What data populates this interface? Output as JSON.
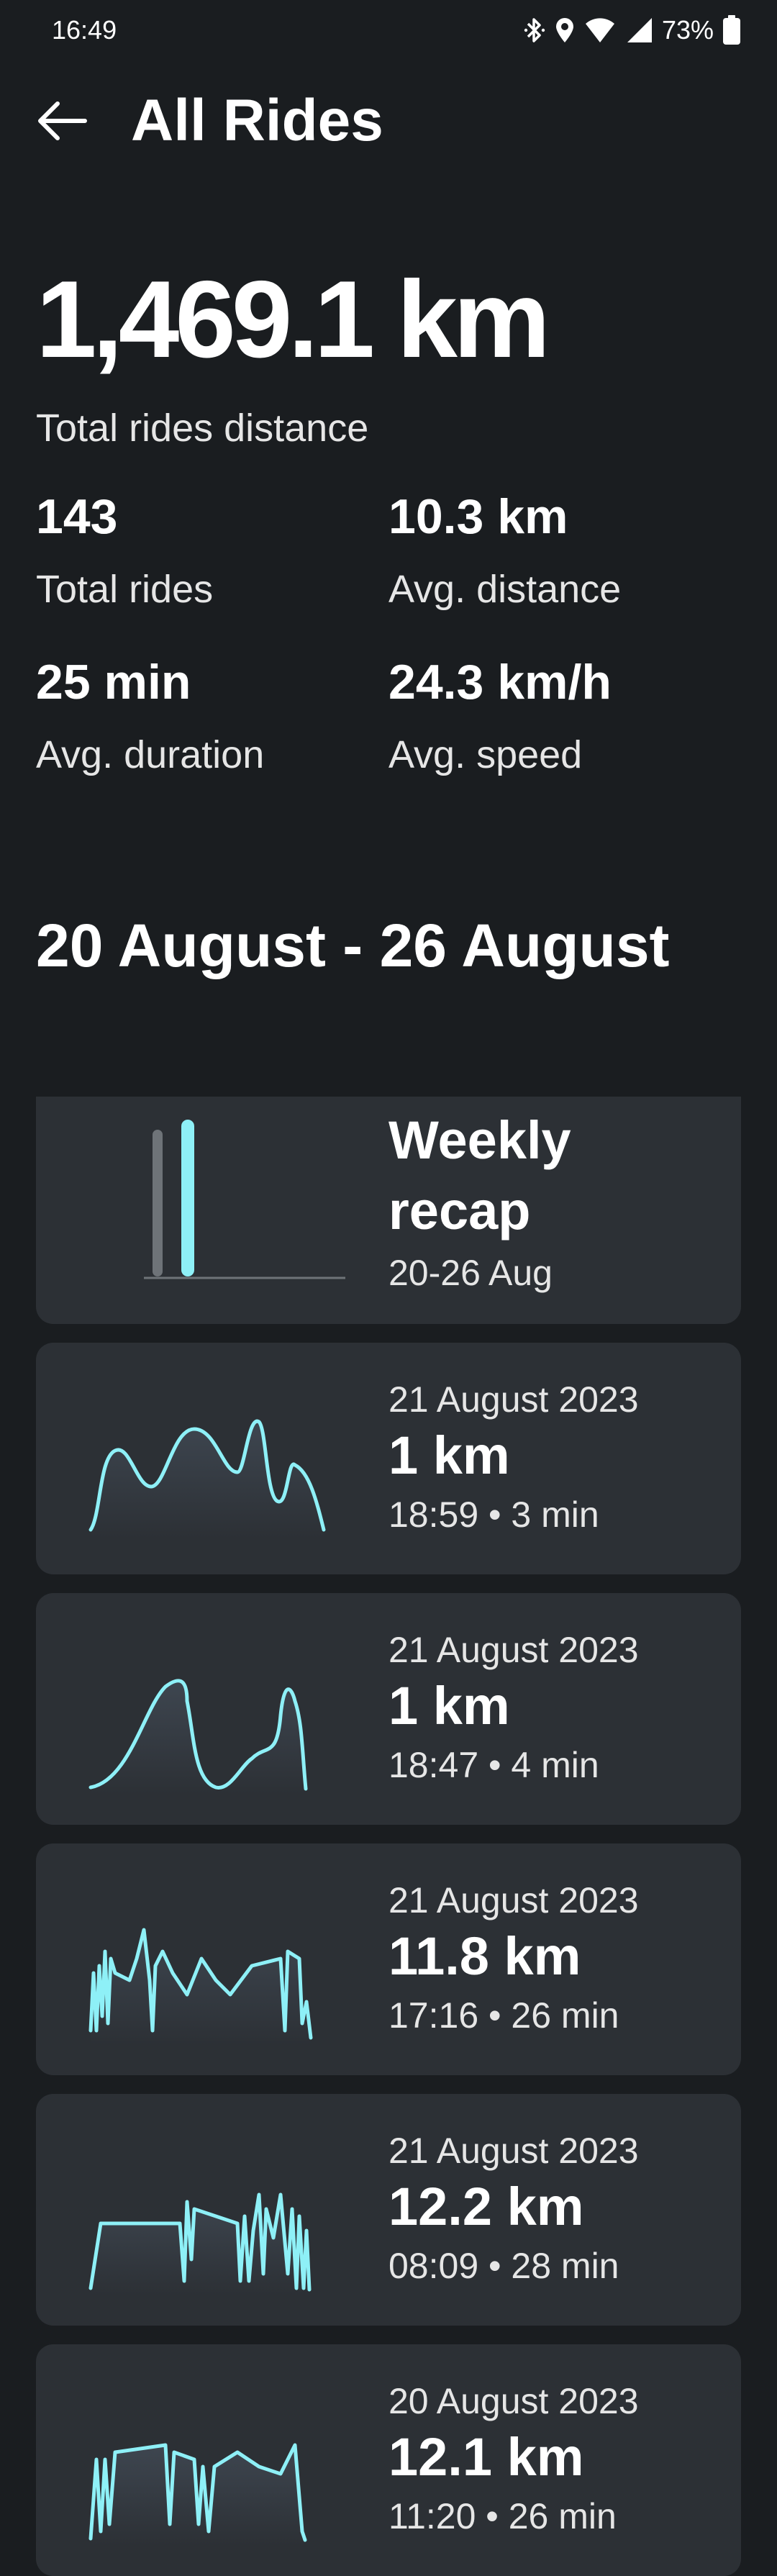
{
  "status_bar": {
    "time": "16:49",
    "battery": "73%",
    "icons": [
      "bluetooth-icon",
      "location-icon",
      "wifi-icon",
      "signal-icon",
      "battery-icon"
    ]
  },
  "header": {
    "title": "All Rides",
    "back_icon": "arrow-left-icon"
  },
  "summary": {
    "total_distance": "1,469.1 km",
    "total_distance_label": "Total rides distance",
    "stats": [
      {
        "value": "143",
        "label": "Total rides"
      },
      {
        "value": "10.3 km",
        "label": "Avg. distance"
      },
      {
        "value": "25 min",
        "label": "Avg. duration"
      },
      {
        "value": "24.3 km/h",
        "label": "Avg. speed"
      }
    ]
  },
  "week": {
    "heading": "20 August - 26 August",
    "recap": {
      "title": "Weekly recap",
      "dates": "20-26 Aug"
    },
    "rides": [
      {
        "date": "21 August 2023",
        "distance": "1 km",
        "meta": "18:59 • 3 min"
      },
      {
        "date": "21 August 2023",
        "distance": "1 km",
        "meta": "18:47 • 4 min"
      },
      {
        "date": "21 August 2023",
        "distance": "11.8 km",
        "meta": "17:16 • 26 min"
      },
      {
        "date": "21 August 2023",
        "distance": "12.2 km",
        "meta": "08:09 • 28 min"
      },
      {
        "date": "20 August 2023",
        "distance": "12.1 km",
        "meta": "11:20 • 26 min"
      }
    ]
  },
  "colors": {
    "background": "#1a1d20",
    "card": "#2c3035",
    "accent": "#8ef0f7",
    "bar_gray": "#6e7378"
  }
}
